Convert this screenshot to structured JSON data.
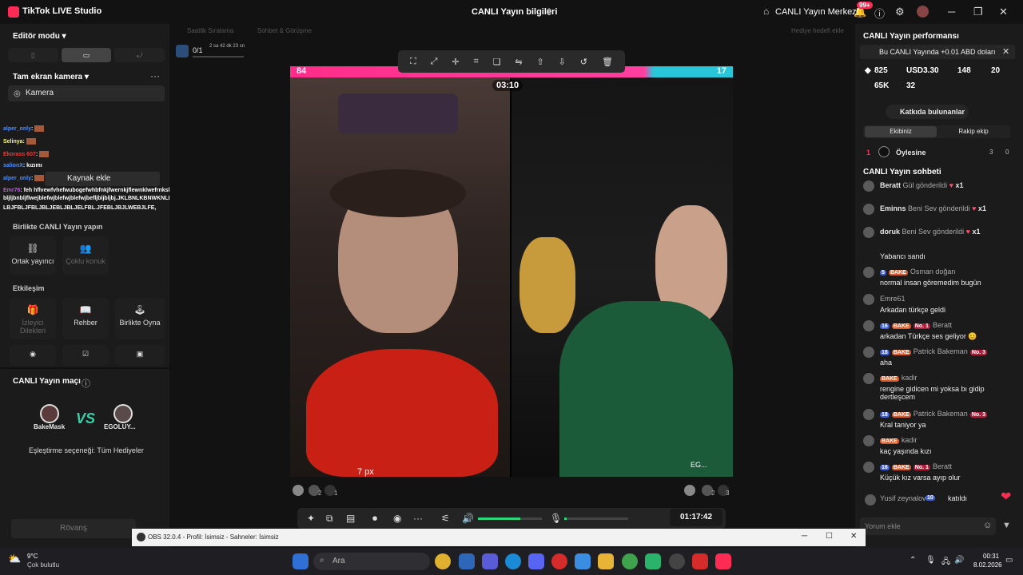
{
  "titlebar": {
    "app": "TikTok LIVE Studio",
    "center": "CANLI Yayın bilgileri",
    "home": "CANLI Yayın Merkezi",
    "badge": "99+"
  },
  "left": {
    "editor": "Editör modu",
    "camera_section": "Tam ekran kamera",
    "camera_item": "Kamera",
    "source_add": "Kaynak ekle",
    "chat": [
      {
        "name": "alper_only",
        "color": "#4c8dff"
      },
      {
        "name": "Selinya",
        "color": "#fefe55"
      },
      {
        "name": "Ekorass 607",
        "color": "#e0403d"
      },
      {
        "name": "salionX",
        "color": "#4c8dff"
      },
      {
        "name": "alper_only",
        "color": "#4c8dff"
      }
    ],
    "salion_text": ": kızımı",
    "emr_name": "Emr76",
    "emr_text": ": feh hflvewfvhefwubogefwhbfnkjfwernkjflewnklwefrnkslwfekjsnlnefkwnljbnbefwqljbwdq",
    "long_line": "bljljbnbljflwejblefwjblefwjblefwjbefljbljbljbj.JKLBNLKBNWKNLKLNBFEFNKFNEEFWNKJLENFKLWLBJFEW",
    "long_line2": "LBJFBLJFBLJBLJEBLJBLJELFBL.JFEBLJBJLWEBJLFE,",
    "together": "Birlikte CANLI Yayın yapın",
    "together_tiles": [
      "Ortak yayıncı",
      "Çoklu konuk"
    ],
    "interaction": "Etkileşim",
    "interaction_tiles": [
      "İzleyici Dilekleri",
      "Rehber",
      "Birlikte Oyna"
    ],
    "match_title": "CANLI Yayın maçı",
    "match_left": "BakeMask",
    "match_right": "EGOLUY...",
    "match_vs": "VS",
    "match_option": "Eşleştirme seçeneği: Tüm Hediyeler",
    "rovans": "Rövanş"
  },
  "stage": {
    "ghost_tabs": [
      "Saatlik Sıralama",
      "Sohbet & Görüşme",
      "Hediye hedefi ekle"
    ],
    "counter": "0/1",
    "counter_time": "2 sa 42 dk 23 sn",
    "pk_left": "84",
    "pk_right": "17",
    "timer": "03:10",
    "px_label": "7 px",
    "right_label": "EG...",
    "duration": "01:17:42",
    "left_counts": [
      "2",
      "1"
    ],
    "right_counts": [
      "2",
      "3"
    ]
  },
  "right": {
    "perf_title": "CANLI Yayın performansı",
    "earn": "Bu CANLI Yayında +0.01 ABD doları",
    "stats": [
      "825",
      "USD3.30",
      "148",
      "20",
      "65K",
      "32"
    ],
    "contributors": "Katkıda bulunanlar",
    "tabs": [
      "Ekibiniz",
      "Rakip ekip"
    ],
    "rank": "1",
    "rank_name": "Öylesine",
    "rank_hearts": "3",
    "rank_gifts": "0",
    "chat_title": "CANLI Yayın sohbeti",
    "gifts": [
      {
        "name": "Beratt",
        "action": "Gül gönderildi",
        "count": "x1"
      },
      {
        "name": "Eminns",
        "action": "Beni Sev gönderildi",
        "count": "x1"
      },
      {
        "name": "doruk",
        "action": "Beni Sev gönderildi",
        "count": "x1"
      }
    ],
    "messages": [
      {
        "badges": [],
        "name": "",
        "text": "Yabancı sandı"
      },
      {
        "badges": [
          "5",
          "BAKE"
        ],
        "name": "Osman doğan",
        "text": "normal insan göremedim bugün"
      },
      {
        "badges": [],
        "name": "Emre61",
        "text": "Arkadan türkçe geldi"
      },
      {
        "badges": [
          "16",
          "BAKE",
          "No. 1"
        ],
        "name": "Beratt",
        "text": "arkadan Türkçe ses geliyor 😊"
      },
      {
        "badges": [
          "18",
          "BAKE"
        ],
        "name": "Patrick Bakeman",
        "extra": "No. 3",
        "text": "aha"
      },
      {
        "badges": [
          "BAKE"
        ],
        "name": "kadir",
        "text": "rengine gidicen mi yoksa bı gidip dertleşcem"
      },
      {
        "badges": [
          "18",
          "BAKE"
        ],
        "name": "Patrick Bakeman",
        "extra": "No. 3",
        "text": "Kral taniyor ya"
      },
      {
        "badges": [
          "BAKE"
        ],
        "name": "kadir",
        "text": "kaç yaşında kızı"
      },
      {
        "badges": [
          "16",
          "BAKE",
          "No. 1"
        ],
        "name": "Beratt",
        "text": "Küçük kız varsa ayıp olur"
      }
    ],
    "join_name": "Yusif zeynalov",
    "join_level": "10",
    "join_text": "katıldı",
    "comment_placeholder": "Yorum ekle"
  },
  "obs": {
    "title": "OBS 32.0.4 - Profil: İsimsiz - Sahneler: İsimsiz"
  },
  "taskbar": {
    "temp": "9°C",
    "weather": "Çok bulutlu",
    "search": "Ara",
    "time": "00:31",
    "date": "8.02.2026"
  }
}
